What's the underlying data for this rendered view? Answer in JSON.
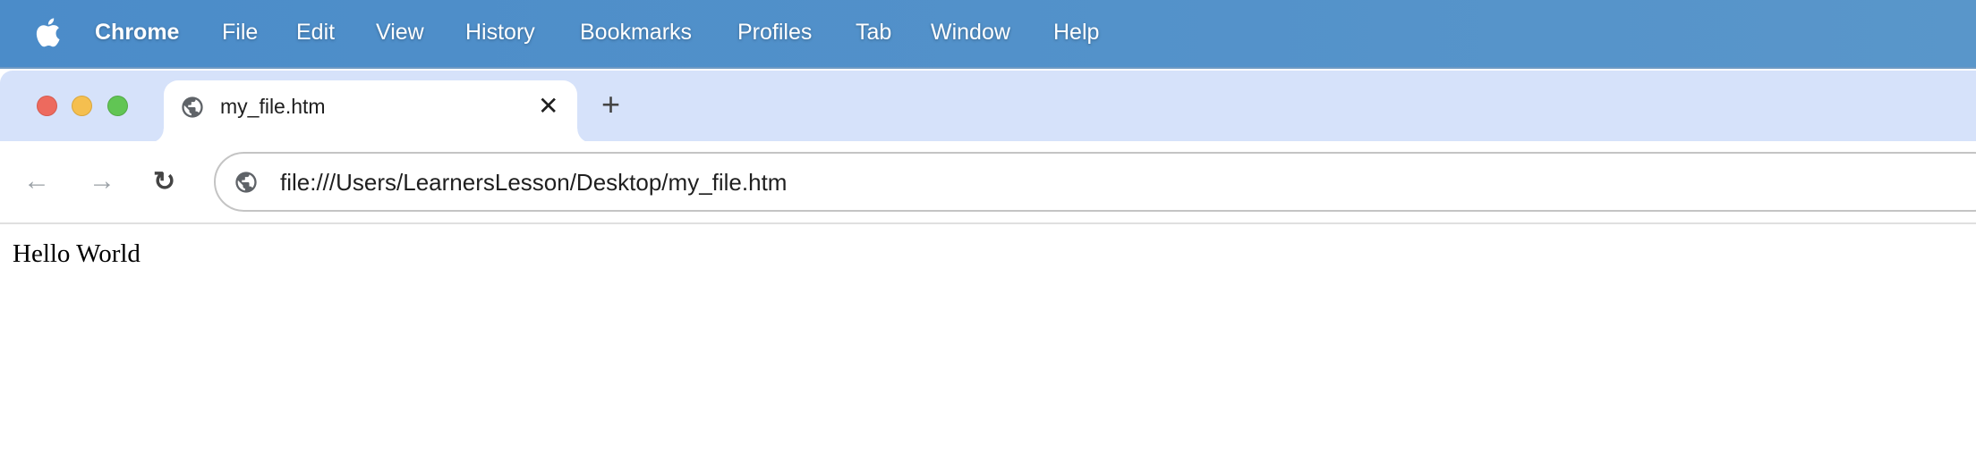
{
  "menubar": {
    "apple_icon": "apple-logo",
    "items": [
      "Chrome",
      "File",
      "Edit",
      "View",
      "History",
      "Bookmarks",
      "Profiles",
      "Tab",
      "Window",
      "Help"
    ]
  },
  "window": {
    "traffic_lights": {
      "close": "#ed6a5e",
      "minimize": "#f5bf4f",
      "zoom": "#61c554"
    }
  },
  "tab": {
    "title": "my_file.htm",
    "icon": "globe-icon",
    "close": "✕",
    "new_tab": "+"
  },
  "toolbar": {
    "back": "←",
    "forward": "→",
    "reload": "↻",
    "url": "file:///Users/LearnersLesson/Desktop/my_file.htm"
  },
  "page": {
    "text": "Hello World"
  },
  "colors": {
    "menubar": "#4f8fc9",
    "tabstrip": "#d6e2fa"
  }
}
